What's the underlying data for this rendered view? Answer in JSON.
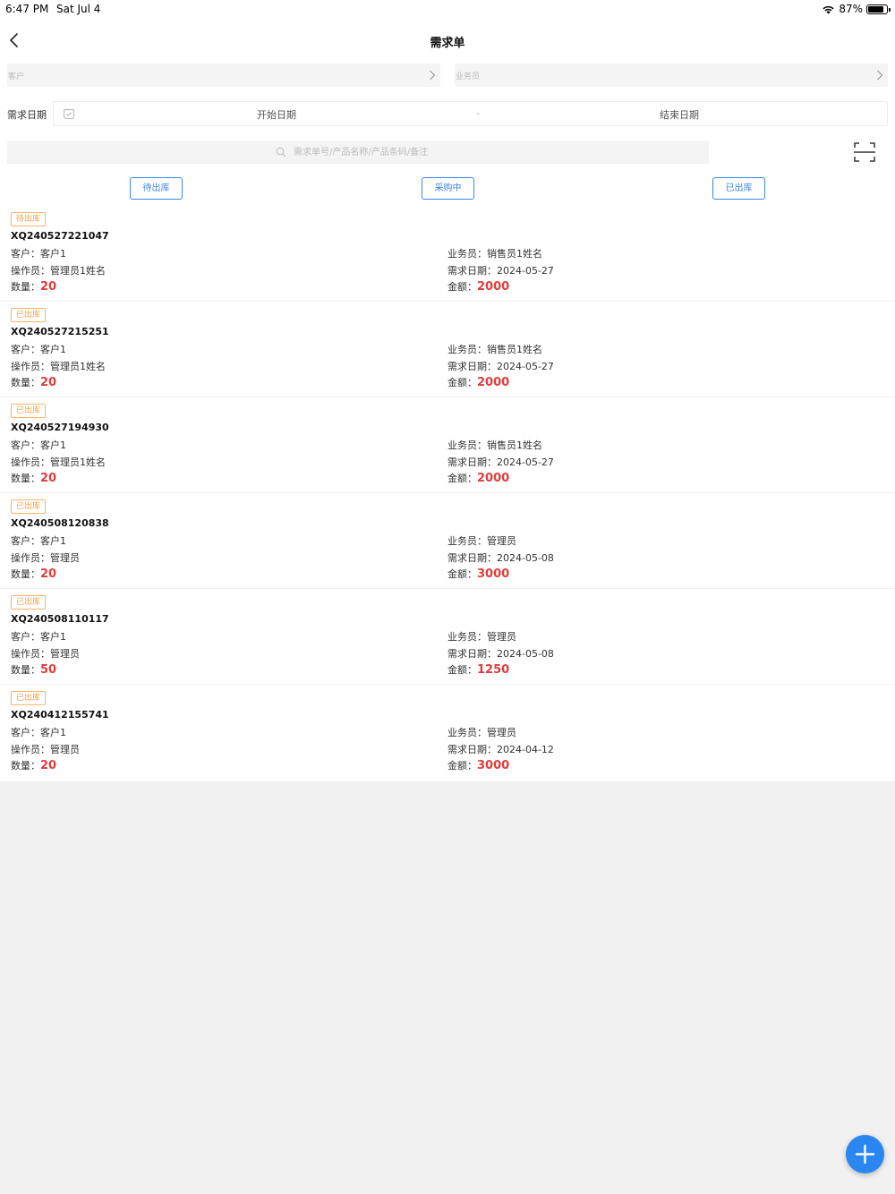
{
  "status_bar": {
    "time": "6:47 PM",
    "date": "Sat Jul 4",
    "battery": "87%",
    "battery_level": 0.87
  },
  "nav": {
    "title": "需求单"
  },
  "filters": {
    "customer_placeholder": "客户",
    "salesperson_placeholder": "业务员",
    "date_label": "需求日期",
    "start_date": "开始日期",
    "separator": "-",
    "end_date": "结束日期",
    "search_placeholder": "需求单号/产品名称/产品条码/备注"
  },
  "status_tabs": [
    {
      "label": "待出库"
    },
    {
      "label": "采购中"
    },
    {
      "label": "已出库"
    }
  ],
  "labels": {
    "customer": "客户：",
    "operator": "操作员：",
    "quantity": "数量：",
    "salesperson": "业务员：",
    "demand_date": "需求日期：",
    "amount": "金额："
  },
  "orders": [
    {
      "status": "待出库",
      "order_no": "XQ240527221047",
      "customer": "客户1",
      "operator": "管理员1姓名",
      "quantity": "20",
      "salesperson": "销售员1姓名",
      "date": "2024-05-27",
      "amount": "2000"
    },
    {
      "status": "已出库",
      "order_no": "XQ240527215251",
      "customer": "客户1",
      "operator": "管理员1姓名",
      "quantity": "20",
      "salesperson": "销售员1姓名",
      "date": "2024-05-27",
      "amount": "2000"
    },
    {
      "status": "已出库",
      "order_no": "XQ240527194930",
      "customer": "客户1",
      "operator": "管理员1姓名",
      "quantity": "20",
      "salesperson": "销售员1姓名",
      "date": "2024-05-27",
      "amount": "2000"
    },
    {
      "status": "已出库",
      "order_no": "XQ240508120838",
      "customer": "客户1",
      "operator": "管理员",
      "quantity": "20",
      "salesperson": "管理员",
      "date": "2024-05-08",
      "amount": "3000"
    },
    {
      "status": "已出库",
      "order_no": "XQ240508110117",
      "customer": "客户1",
      "operator": "管理员",
      "quantity": "50",
      "salesperson": "管理员",
      "date": "2024-05-08",
      "amount": "1250"
    },
    {
      "status": "已出库",
      "order_no": "XQ240412155741",
      "customer": "客户1",
      "operator": "管理员",
      "quantity": "20",
      "salesperson": "管理员",
      "date": "2024-04-12",
      "amount": "3000"
    }
  ],
  "icons": {
    "back": "chevron-left-icon",
    "scan": "scan-icon",
    "search": "search-icon",
    "calendar": "calendar-icon",
    "fab": "plus-icon"
  },
  "colors": {
    "accent": "#3a86e8",
    "fab": "#2a86f0",
    "tag": "#f0a04a",
    "value_red": "#e03d3d"
  }
}
